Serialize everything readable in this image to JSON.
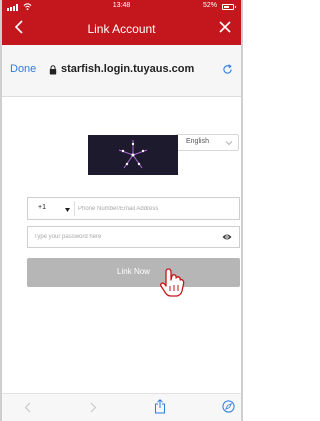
{
  "status_bar": {
    "time": "13:48",
    "battery": "52%"
  },
  "nav": {
    "title": "Link Account",
    "back_icon": "chevron-left-icon",
    "close_icon": "close-icon"
  },
  "browser": {
    "done_label": "Done",
    "url": "starfish.login.tuyaus.com",
    "lock_icon": "lock-icon",
    "reload_icon": "reload-icon"
  },
  "form": {
    "language": "English",
    "country_code": "+1",
    "phone_placeholder": "Phone Number/Email Address",
    "password_placeholder": "Type your password here",
    "link_button": "Link Now"
  },
  "toolbar": {
    "icons": [
      "back-icon",
      "forward-icon",
      "share-icon",
      "compass-icon"
    ]
  },
  "colors": {
    "header": "#c4171d",
    "link_blue": "#2f7de1",
    "button_disabled": "#b6b6b6"
  }
}
